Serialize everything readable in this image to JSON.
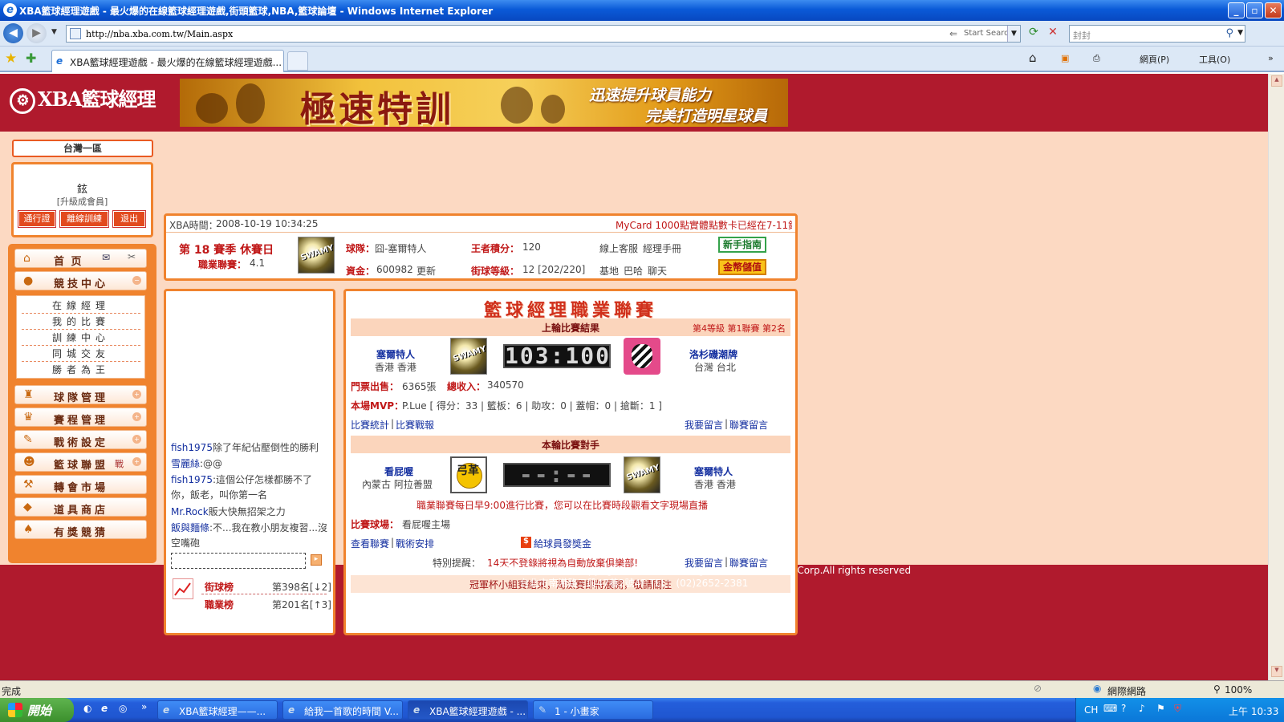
{
  "window": {
    "title": "XBA籃球經理遊戲 - 最火爆的在線籃球經理遊戲,街頭籃球,NBA,籃球論壇 - Windows Internet Explorer",
    "minimize": "_",
    "maximize": "▫",
    "close": "✕"
  },
  "browser": {
    "url": "http://nba.xba.com.tw/Main.aspx",
    "start_search_placeholder": "Start Search",
    "search_value": "封封",
    "tab_title": "XBA籃球經理遊戲 - 最火爆的在線籃球經理遊戲...",
    "cmd_page": "網頁(P)",
    "cmd_tools": "工具(O)"
  },
  "site": {
    "logo_text": "XBA籃球經理",
    "banner_title": "極速特訓",
    "banner_line1": "迅速提升球員能力",
    "banner_line2": "完美打造明星球員"
  },
  "sidebar": {
    "server": "台灣一區",
    "user_name": "鉉",
    "user_level": "[升級成會員]",
    "btn_pass": "通行證",
    "btn_train": "離線訓練",
    "btn_logout": "退出",
    "home": "首 页",
    "menu": [
      {
        "label": "競技中心",
        "icon": "basketball-icon"
      },
      {
        "label": "球隊管理",
        "icon": "team-icon"
      },
      {
        "label": "賽程管理",
        "icon": "trophy-icon"
      },
      {
        "label": "戰術設定",
        "icon": "tactics-icon"
      },
      {
        "label": "籃球聯盟",
        "icon": "league-icon"
      },
      {
        "label": "轉會市場",
        "icon": "hammer-icon"
      },
      {
        "label": "道具商店",
        "icon": "shop-icon"
      },
      {
        "label": "有獎競猜",
        "icon": "quiz-icon"
      }
    ],
    "league_badge": "戰",
    "submenu": [
      "在線經理",
      "我的比賽",
      "訓練中心",
      "同城交友",
      "勝者為王"
    ]
  },
  "info": {
    "time_label": "XBA時間：",
    "time_value": "2008-10-19 10:34:25",
    "notice": "MyCard 1000點實體點數卡已經在7-11銷",
    "season": "第 18 賽季  休賽日",
    "pro_label": "職業聯賽：",
    "pro_value": "4.1",
    "team_label": "球隊：",
    "team_value": "囧-塞爾特人",
    "king_label": "王者積分：",
    "king_value": "120",
    "cs_link": "線上客服",
    "manual_link": "經理手冊",
    "funds_label": "資金：",
    "funds_value": "600982",
    "update_link": "更新",
    "street_label": "街球等級：",
    "street_value": "12 [202/220]",
    "base_link": "基地",
    "bar_link": "巴哈",
    "chat_link": "聊天",
    "btn_newbie": "新手指南",
    "btn_gold": "金幣儲值"
  },
  "chat": {
    "messages": [
      {
        "user": "fish1975",
        "text": "除了年紀佔壓倒性的勝利"
      },
      {
        "user": "雪麗絲",
        "text": ":@@"
      },
      {
        "user": "fish1975",
        "text": ":這個公仔怎樣都勝不了你，飯老，叫你第一名"
      },
      {
        "user": "Mr.Rock",
        "text": "販大快無招架之力"
      },
      {
        "user": "飯與麵條",
        "text": ":不...我在教小朋友複習...沒空嘴砲"
      }
    ],
    "rank_street_label": "街球榜",
    "rank_street_value": "第398名[↓2]",
    "rank_pro_label": "職業榜",
    "rank_pro_value": "第201名[↑3]"
  },
  "league": {
    "title": "籃球經理職業聯賽",
    "last_header": "上輪比賽結果",
    "last_meta": "第4等級  第1聯賽  第2名",
    "home_team": "塞爾特人",
    "home_city": "香港  香港",
    "home_logo_text": "SWAMY",
    "score": "103:100",
    "away_team": "洛杉磯潮牌",
    "away_city": "台灣  台北",
    "tickets_label": "門票出售：",
    "tickets_value": "6365張",
    "income_label": "總收入：",
    "income_value": "340570",
    "mvp_label": "本場MVP：",
    "mvp_value": "P.Lue [ 得分：33 | 籃板：6 | 助攻：0 | 蓋帽：0 | 搶斷：1 ]",
    "stats_link": "比賽統計",
    "report_link": "比賽戰報",
    "msg_link": "我要留言",
    "league_msg_link": "聯賽留言",
    "next_header": "本輪比賽對手",
    "next_home_team": "看屁喔",
    "next_home_city": "內蒙古  阿拉善盟",
    "next_home_logo_text": "弓革",
    "next_score": "--:--",
    "next_away_team": "塞爾特人",
    "next_away_city": "香港  香港",
    "schedule_note": "職業聯賽每日早9:00進行比賽，您可以在比賽時段觀看文字現場直播",
    "venue_label": "比賽球場：",
    "venue_value": "看屁喔主場",
    "view_league_link": "查看聯賽",
    "tactics_link": "戰術安排",
    "bonus_link": "給球員發獎金",
    "reminder_label": "特別提醒：",
    "reminder_text": "14天不登錄將視為自動放棄俱樂部!",
    "cup_notice": "冠軍杯小組賽結束，淘汰賽即將展開，敬請關注"
  },
  "footer": {
    "line1": "中華網龍股份有限公司  XBA籃球經理2008 v0510     Copyright，2008 Chinesegamer International Corp.All rights reserved",
    "line2": "台北市南港路三段47巷2號4F TEL：(02)2652-2381"
  },
  "status": {
    "text": "完成",
    "zone": "網際網路",
    "zoom": "100%"
  },
  "taskbar": {
    "start": "開始",
    "buttons": [
      "XBA籃球經理——...",
      "給我一首歌的時間 V...",
      "XBA籃球經理遊戲 - ...",
      "1 - 小畫家"
    ],
    "lang": "CH",
    "clock": "上午 10:33"
  }
}
